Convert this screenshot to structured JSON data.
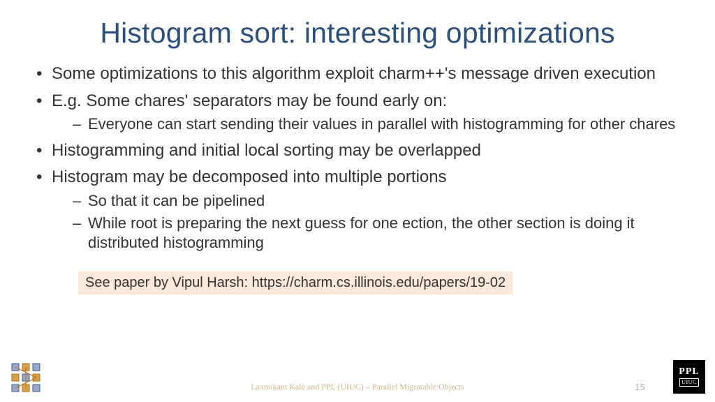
{
  "title": "Histogram sort: interesting optimizations",
  "bullets": [
    {
      "text": "Some optimizations to this algorithm exploit charm++'s message driven execution",
      "sub": []
    },
    {
      "text": "E.g. Some chares' separators may be found early on:",
      "sub": [
        "Everyone can start sending their values in parallel with histogramming for other chares"
      ]
    },
    {
      "text": "Histogramming and initial local sorting may be overlapped",
      "sub": []
    },
    {
      "text": "Histogram may be decomposed into multiple portions",
      "sub": [
        "So that it can be pipelined",
        "While root is preparing the next guess for one ection, the other section is doing it distributed histogramming"
      ]
    }
  ],
  "note": "See paper by Vipul Harsh: https://charm.cs.illinois.edu/papers/19-02",
  "footer": "Laxmikant Kalé and PPL (UIUC) – Parallel Migratable Objects",
  "page": "15",
  "logo_right": {
    "top": "PPL",
    "bottom": "UIUC"
  }
}
